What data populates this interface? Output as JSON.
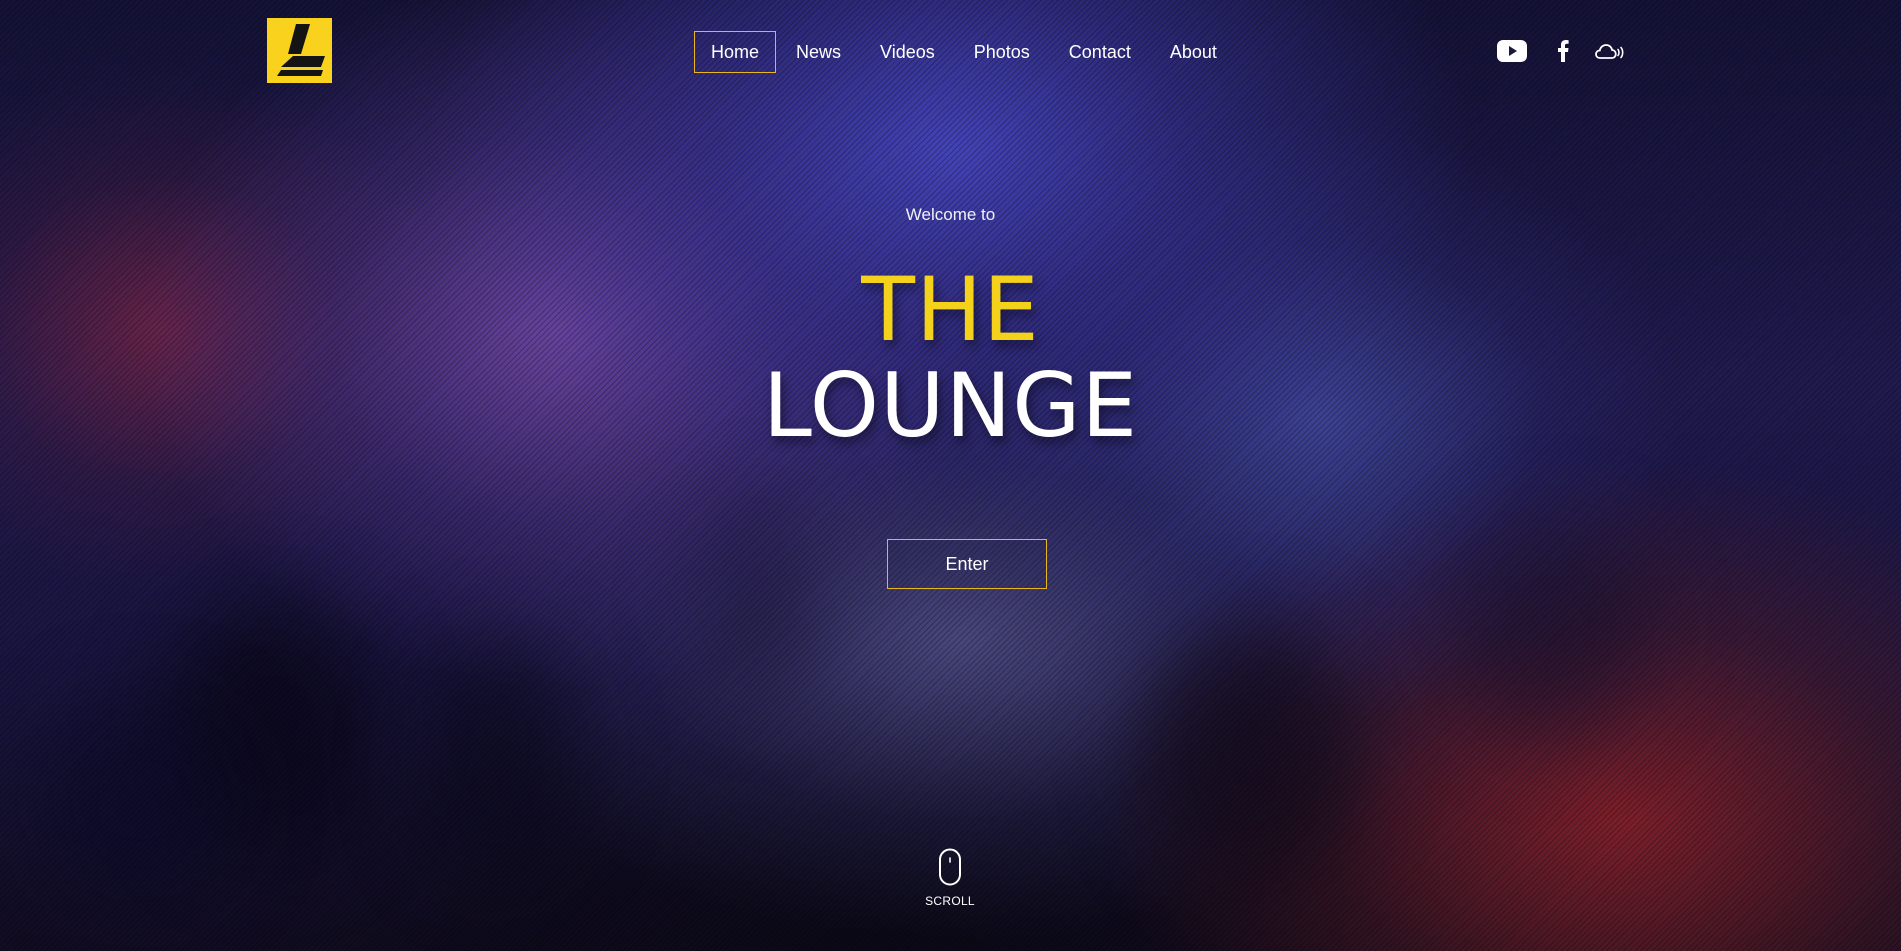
{
  "brand": {
    "logo_icon": "stylized-L-logo-icon",
    "accent_color": "#f8d21c"
  },
  "nav": {
    "items": [
      {
        "label": "Home",
        "active": true
      },
      {
        "label": "News",
        "active": false
      },
      {
        "label": "Videos",
        "active": false
      },
      {
        "label": "Photos",
        "active": false
      },
      {
        "label": "Contact",
        "active": false
      },
      {
        "label": "About",
        "active": false
      }
    ]
  },
  "social": {
    "icons": [
      "youtube-icon",
      "facebook-icon",
      "soundcloud-icon"
    ]
  },
  "hero": {
    "welcome": "Welcome to",
    "title_line1": "THE",
    "title_line2": "LOUNGE",
    "title_line1_color": "#f4d21b",
    "title_line2_color": "#ffffff",
    "enter_label": "Enter"
  },
  "scroll": {
    "label": "SCROLL",
    "icon": "mouse-scroll-icon"
  }
}
